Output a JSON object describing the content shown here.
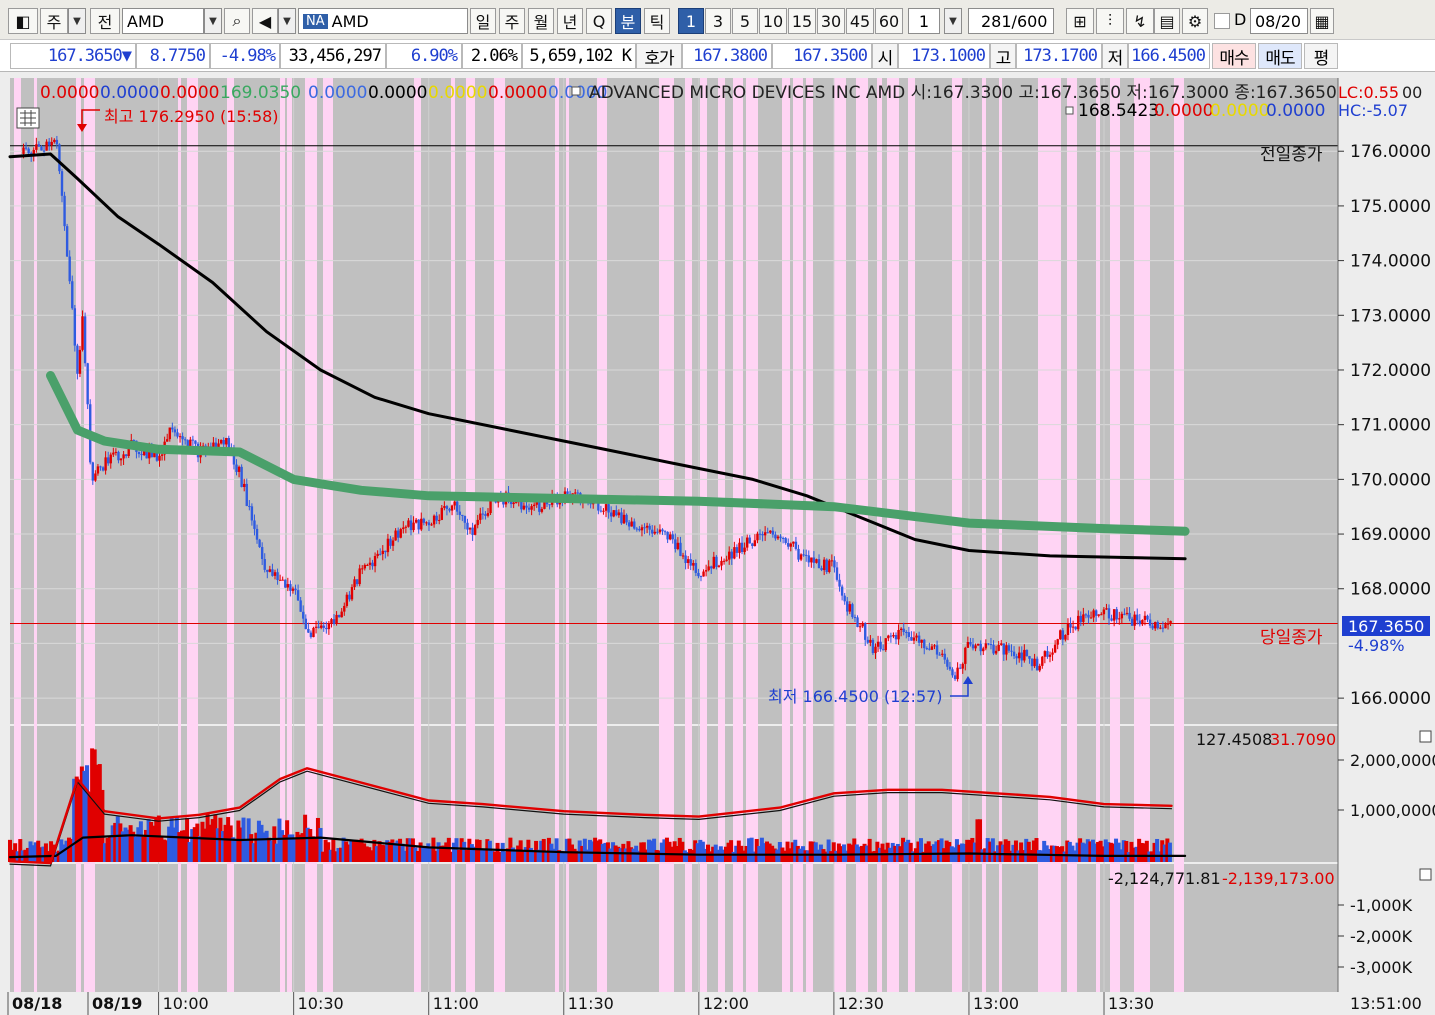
{
  "toolbar": {
    "market_type": "주",
    "period_flag": "전",
    "symbol_input": "AMD",
    "exchange_badge": "NA",
    "symbol_name": "AMD",
    "period_tabs": [
      "일",
      "주",
      "월",
      "년",
      "Q",
      "분",
      "틱"
    ],
    "selected_period": "분",
    "minute_options": [
      "1",
      "3",
      "5",
      "10",
      "15",
      "30",
      "45",
      "60"
    ],
    "selected_minute": "1",
    "multiplier": "1",
    "count_value": "281",
    "count_max": "/600",
    "date_checkbox_label": "D",
    "date_value": "08/20"
  },
  "quote": {
    "price": "167.3650",
    "down_marker": "▼",
    "change": "8.7750",
    "change_pct": "-4.98%",
    "volume": "33,456,297",
    "ratio1": "6.90%",
    "ratio2": "2.06%",
    "amount": "5,659,102 K",
    "hoga_label": "호가",
    "ask": "167.3800",
    "bid": "167.3500",
    "open_label": "시",
    "open": "173.1000",
    "high_label": "고",
    "high": "173.1700",
    "low_label": "저",
    "low": "166.4500",
    "buy_label": "매수",
    "sell_label": "매도",
    "avg_label": "평"
  },
  "price_panel": {
    "indicator_values": [
      {
        "text": "0.0000",
        "color": "#e00000"
      },
      {
        "text": "0.0000",
        "color": "#1f3fd0"
      },
      {
        "text": "0.0000",
        "color": "#e00000"
      },
      {
        "text": "169.0350",
        "color": "#3aa860"
      },
      {
        "text": "0.0000",
        "color": "#3c6ae0"
      },
      {
        "text": "0.0000",
        "color": "#000000"
      },
      {
        "text": "0.0000",
        "color": "#e8d800"
      },
      {
        "text": "0.0000",
        "color": "#e00000"
      },
      {
        "text": "0.0000",
        "color": "#3c6ae0"
      }
    ],
    "instrument_label": "ADVANCED MICRO DEVICES INC  AMD 시:167.3300 고:167.3650 저:167.3000 종:167.3650",
    "lc_label": "LC:0.55",
    "hc_label": "HC:-5.07",
    "second_line": [
      {
        "text": "168.5423",
        "color": "#000000"
      },
      {
        "text": "0.0000",
        "color": "#e00000"
      },
      {
        "text": "0.0000",
        "color": "#e8d800"
      },
      {
        "text": "0.0000",
        "color": "#1f3fd0"
      }
    ],
    "high_annotation": "최고 176.2950 (15:58)",
    "low_annotation": "최저 166.4500 (12:57)",
    "prev_close_label": "전일종가",
    "today_close_label": "당일종가",
    "current_price_tag": "167.3650",
    "current_pct_tag": "-4.98%",
    "y_ticks": [
      "176.0000",
      "175.0000",
      "174.0000",
      "173.0000",
      "172.0000",
      "171.0000",
      "170.0000",
      "169.0000",
      "168.0000",
      "166.0000"
    ],
    "y_tick_trailing": "00"
  },
  "volume_panel": {
    "value_left": "127.4508",
    "value_right": "31.7090",
    "y_ticks": [
      "2,000,0000",
      "1,000,0000"
    ]
  },
  "obv_panel": {
    "value_left": "-2,124,771.81",
    "value_right": "-2,139,173.00",
    "y_ticks": [
      "-1,000K",
      "-2,000K",
      "-3,000K"
    ]
  },
  "x_axis": {
    "labels": [
      "08/18",
      "08/19",
      "10:00",
      "10:30",
      "11:00",
      "11:30",
      "12:00",
      "12:30",
      "13:00",
      "13:30"
    ],
    "current_time": "13:51:00"
  },
  "colors": {
    "up": "#e00000",
    "down": "#2f5be0",
    "ma_long": "#000000",
    "ma_mid": "#4aa06a",
    "pink_band": "#ffd4f4",
    "chart_bg": "#c0c0c0"
  },
  "chart_data": {
    "type": "candlestick",
    "price_range": [
      165.6,
      176.9
    ],
    "prev_close": 176.1,
    "current": 167.365,
    "price_path": [
      [
        9.5,
        175.95
      ],
      [
        9.56,
        176.05
      ],
      [
        9.62,
        176.295
      ],
      [
        9.7,
        172.0
      ],
      [
        9.72,
        173.0
      ],
      [
        9.75,
        170.0
      ],
      [
        9.8,
        170.3
      ],
      [
        9.9,
        170.6
      ],
      [
        10.0,
        170.4
      ],
      [
        10.05,
        171.0
      ],
      [
        10.15,
        170.5
      ],
      [
        10.25,
        170.7
      ],
      [
        10.3,
        170.1
      ],
      [
        10.4,
        168.3
      ],
      [
        10.5,
        168.0
      ],
      [
        10.55,
        167.2
      ],
      [
        10.65,
        167.4
      ],
      [
        10.75,
        168.3
      ],
      [
        10.9,
        169.1
      ],
      [
        11.0,
        169.2
      ],
      [
        11.1,
        169.6
      ],
      [
        11.15,
        169.0
      ],
      [
        11.25,
        169.7
      ],
      [
        11.4,
        169.5
      ],
      [
        11.5,
        169.7
      ],
      [
        11.65,
        169.5
      ],
      [
        11.75,
        169.2
      ],
      [
        11.9,
        168.9
      ],
      [
        12.0,
        168.3
      ],
      [
        12.1,
        168.6
      ],
      [
        12.2,
        168.9
      ],
      [
        12.3,
        169.0
      ],
      [
        12.4,
        168.5
      ],
      [
        12.5,
        168.4
      ],
      [
        12.55,
        167.7
      ],
      [
        12.65,
        166.9
      ],
      [
        12.75,
        167.2
      ],
      [
        12.85,
        167.0
      ],
      [
        12.95,
        166.45
      ],
      [
        13.0,
        167.0
      ],
      [
        13.1,
        166.9
      ],
      [
        13.2,
        166.8
      ],
      [
        13.25,
        166.6
      ],
      [
        13.35,
        167.2
      ],
      [
        13.45,
        167.6
      ],
      [
        13.55,
        167.5
      ],
      [
        13.65,
        167.4
      ],
      [
        13.75,
        167.3
      ]
    ],
    "ma_mid_path": [
      [
        9.6,
        171.9
      ],
      [
        9.7,
        170.9
      ],
      [
        9.8,
        170.7
      ],
      [
        10.0,
        170.55
      ],
      [
        10.3,
        170.5
      ],
      [
        10.5,
        170.0
      ],
      [
        10.75,
        169.8
      ],
      [
        11.0,
        169.7
      ],
      [
        11.5,
        169.65
      ],
      [
        12.0,
        169.6
      ],
      [
        12.5,
        169.5
      ],
      [
        13.0,
        169.2
      ],
      [
        13.5,
        169.1
      ],
      [
        13.8,
        169.05
      ]
    ],
    "ma_long_path": [
      [
        9.45,
        175.9
      ],
      [
        9.6,
        175.95
      ],
      [
        9.7,
        175.5
      ],
      [
        9.85,
        174.8
      ],
      [
        10.0,
        174.3
      ],
      [
        10.2,
        173.6
      ],
      [
        10.4,
        172.7
      ],
      [
        10.6,
        172.0
      ],
      [
        10.8,
        171.5
      ],
      [
        11.0,
        171.2
      ],
      [
        11.3,
        170.9
      ],
      [
        11.6,
        170.6
      ],
      [
        11.9,
        170.3
      ],
      [
        12.2,
        170.0
      ],
      [
        12.4,
        169.7
      ],
      [
        12.6,
        169.3
      ],
      [
        12.8,
        168.9
      ],
      [
        13.0,
        168.7
      ],
      [
        13.3,
        168.6
      ],
      [
        13.8,
        168.55
      ]
    ],
    "obv_path": [
      [
        9.45,
        -0.6
      ],
      [
        9.6,
        -0.55
      ],
      [
        9.7,
        -2.9
      ],
      [
        9.8,
        -2.0
      ],
      [
        10.0,
        -1.8
      ],
      [
        10.15,
        -1.9
      ],
      [
        10.3,
        -2.1
      ],
      [
        10.45,
        -2.9
      ],
      [
        10.55,
        -3.2
      ],
      [
        10.7,
        -2.9
      ],
      [
        10.9,
        -2.5
      ],
      [
        11.0,
        -2.3
      ],
      [
        11.2,
        -2.2
      ],
      [
        11.5,
        -2.0
      ],
      [
        11.8,
        -1.9
      ],
      [
        12.0,
        -1.85
      ],
      [
        12.3,
        -2.1
      ],
      [
        12.5,
        -2.5
      ],
      [
        12.7,
        -2.6
      ],
      [
        12.9,
        -2.6
      ],
      [
        13.1,
        -2.5
      ],
      [
        13.3,
        -2.4
      ],
      [
        13.5,
        -2.2
      ],
      [
        13.75,
        -2.15
      ]
    ]
  }
}
